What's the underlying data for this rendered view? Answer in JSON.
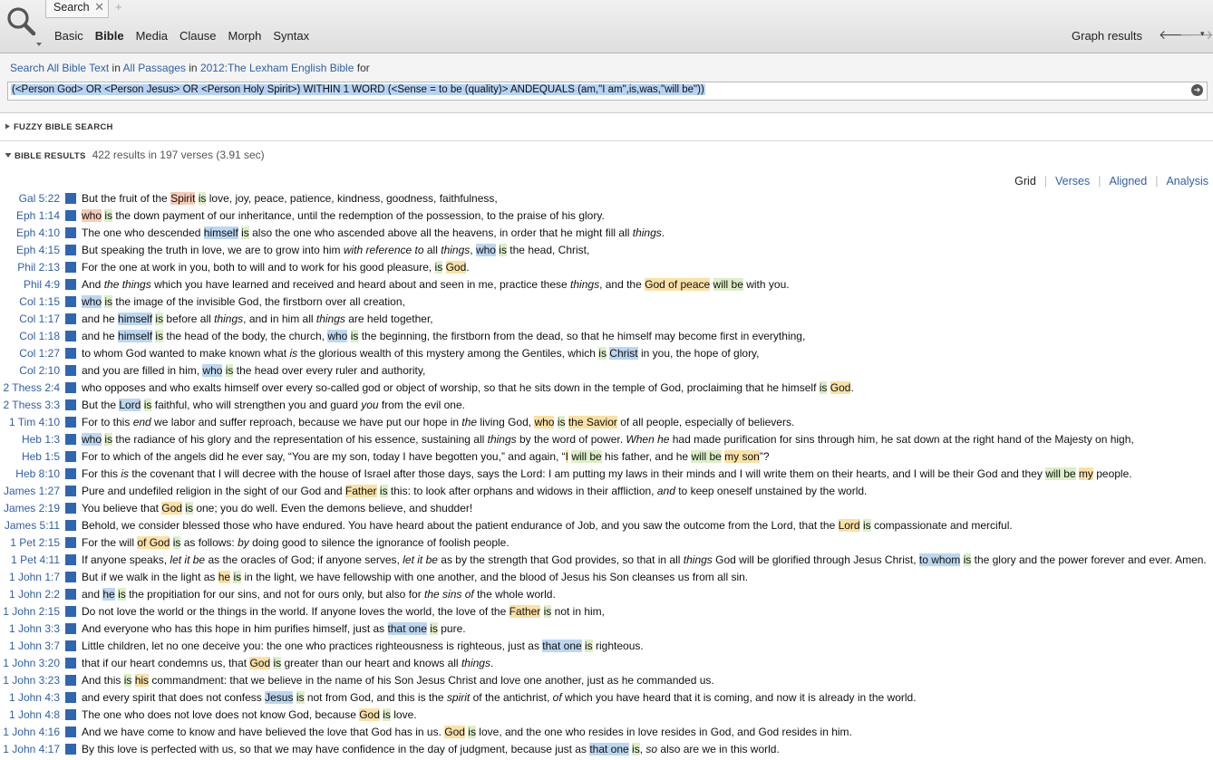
{
  "app": {
    "tab_label": "Search",
    "tab_close": "✕",
    "tab_new": "+",
    "modes": [
      "Basic",
      "Bible",
      "Media",
      "Clause",
      "Morph",
      "Syntax"
    ],
    "active_mode": "Bible",
    "graph_results_label": "Graph results",
    "nav_back": "🡐",
    "nav_forward": "🡒",
    "nav_menu": "▾"
  },
  "criteria": {
    "search_label": "Search",
    "scope_label": "All Bible Text",
    "in1": "in",
    "passages_label": "All Passages",
    "in2": "in",
    "resource_label": "2012:The Lexham English Bible",
    "for_label": "for",
    "query": "(<Person God> OR <Person Jesus> OR <Person Holy Spirit>) WITHIN 1 WORD (<Sense = to be (quality)> ANDEQUALS (am,\"I am\",is,was,\"will be\"))",
    "go_icon": "➔"
  },
  "sections": {
    "fuzzy_label": "FUZZY BIBLE SEARCH",
    "results_label": "BIBLE RESULTS",
    "results_count": "422 results in 197 verses (3.91 sec)"
  },
  "views": [
    "Grid",
    "Verses",
    "Aligned",
    "Analysis"
  ],
  "current_view": "Grid",
  "colors": {
    "link": "#2f5fa8",
    "marker": "#2f66b2",
    "hl_blue": "#bcd7f0",
    "hl_yellow": "#fbe1a6",
    "hl_green": "#dcefc8",
    "hl_orange": "#f6cbb5"
  },
  "results": [
    {
      "ref": "Gal 5:22",
      "segs": [
        [
          "But the fruit of the ",
          ""
        ],
        [
          "Spirit",
          "h4"
        ],
        [
          " ",
          ""
        ],
        [
          "is",
          "h3"
        ],
        [
          " love, joy, peace, patience, kindness, goodness, faithfulness,",
          ""
        ]
      ]
    },
    {
      "ref": "Eph 1:14",
      "segs": [
        [
          "who",
          "h4"
        ],
        [
          " ",
          ""
        ],
        [
          "is",
          "h3"
        ],
        [
          " the down payment of our inheritance, until the redemption of the possession, to the praise of his glory.",
          ""
        ]
      ]
    },
    {
      "ref": "Eph 4:10",
      "segs": [
        [
          "The one who descended ",
          ""
        ],
        [
          "himself",
          "h1"
        ],
        [
          " ",
          ""
        ],
        [
          "is",
          "h3"
        ],
        [
          " also the one who ascended above all the heavens, in order that he might fill all ",
          ""
        ],
        [
          "things",
          "i"
        ],
        [
          ".",
          ""
        ]
      ]
    },
    {
      "ref": "Eph 4:15",
      "segs": [
        [
          "But speaking the truth in love, we are to grow into him ",
          ""
        ],
        [
          "with reference to",
          "i"
        ],
        [
          " all ",
          ""
        ],
        [
          "things",
          "i"
        ],
        [
          ", ",
          ""
        ],
        [
          "who",
          "h1"
        ],
        [
          " ",
          ""
        ],
        [
          "is",
          "h3"
        ],
        [
          " the head, Christ,",
          ""
        ]
      ]
    },
    {
      "ref": "Phil 2:13",
      "segs": [
        [
          "For the one at work in you, both to will and to work for his good pleasure, ",
          ""
        ],
        [
          "is",
          "h3"
        ],
        [
          " ",
          ""
        ],
        [
          "God",
          "h2"
        ],
        [
          ".",
          ""
        ]
      ]
    },
    {
      "ref": "Phil 4:9",
      "segs": [
        [
          "And ",
          ""
        ],
        [
          "the things",
          "i"
        ],
        [
          " which you have learned and received and heard about and seen in me, practice these ",
          ""
        ],
        [
          "things",
          "i"
        ],
        [
          ", and the ",
          ""
        ],
        [
          "God of peace",
          "h2"
        ],
        [
          " ",
          ""
        ],
        [
          "will be",
          "h3"
        ],
        [
          " with you.",
          ""
        ]
      ]
    },
    {
      "ref": "Col 1:15",
      "segs": [
        [
          "who",
          "h1"
        ],
        [
          " ",
          ""
        ],
        [
          "is",
          "h3"
        ],
        [
          " the image of the invisible God, the firstborn over all creation,",
          ""
        ]
      ]
    },
    {
      "ref": "Col 1:17",
      "segs": [
        [
          "and he ",
          ""
        ],
        [
          "himself",
          "h1"
        ],
        [
          " ",
          ""
        ],
        [
          "is",
          "h3"
        ],
        [
          " before all ",
          ""
        ],
        [
          "things",
          "i"
        ],
        [
          ", and in him all ",
          ""
        ],
        [
          "things",
          "i"
        ],
        [
          " are held together,",
          ""
        ]
      ]
    },
    {
      "ref": "Col 1:18",
      "segs": [
        [
          "and he ",
          ""
        ],
        [
          "himself",
          "h1"
        ],
        [
          " ",
          ""
        ],
        [
          "is",
          "h3"
        ],
        [
          " the head of the body, the church, ",
          ""
        ],
        [
          "who",
          "h1"
        ],
        [
          " ",
          ""
        ],
        [
          "is",
          "h3"
        ],
        [
          " the beginning, the firstborn from the dead, so that he himself may become first in everything,",
          ""
        ]
      ]
    },
    {
      "ref": "Col 1:27",
      "segs": [
        [
          "to whom God wanted to make known what ",
          ""
        ],
        [
          "is",
          "i"
        ],
        [
          " the glorious wealth of this mystery among the Gentiles, which ",
          ""
        ],
        [
          "is",
          "h3"
        ],
        [
          " ",
          ""
        ],
        [
          "Christ",
          "h1"
        ],
        [
          " in you, the hope of glory,",
          ""
        ]
      ]
    },
    {
      "ref": "Col 2:10",
      "segs": [
        [
          "and you are filled in him, ",
          ""
        ],
        [
          "who",
          "h1"
        ],
        [
          " ",
          ""
        ],
        [
          "is",
          "h3"
        ],
        [
          " the head over every ruler and authority,",
          ""
        ]
      ]
    },
    {
      "ref": "2 Thess 2:4",
      "segs": [
        [
          "who opposes and who exalts himself over every so-called god or object of worship, so that he sits down in the temple of God, proclaiming that he himself ",
          ""
        ],
        [
          "is",
          "h3"
        ],
        [
          " ",
          ""
        ],
        [
          "God",
          "h2"
        ],
        [
          ".",
          ""
        ]
      ]
    },
    {
      "ref": "2 Thess 3:3",
      "segs": [
        [
          "But the ",
          ""
        ],
        [
          "Lord",
          "h1"
        ],
        [
          " ",
          ""
        ],
        [
          "is",
          "h3"
        ],
        [
          " faithful, who will strengthen you and guard ",
          ""
        ],
        [
          "you",
          "i"
        ],
        [
          " from the evil one.",
          ""
        ]
      ]
    },
    {
      "ref": "1 Tim 4:10",
      "segs": [
        [
          "For to this ",
          ""
        ],
        [
          "end",
          "i"
        ],
        [
          " we labor and suffer reproach, because we have put our hope in ",
          ""
        ],
        [
          "the",
          "i"
        ],
        [
          " living God, ",
          ""
        ],
        [
          "who",
          "h2"
        ],
        [
          " ",
          ""
        ],
        [
          "is",
          "h3"
        ],
        [
          " ",
          ""
        ],
        [
          "the Savior",
          "h2"
        ],
        [
          " of all people, especially of believers.",
          ""
        ]
      ]
    },
    {
      "ref": "Heb 1:3",
      "segs": [
        [
          "who",
          "h1"
        ],
        [
          " ",
          ""
        ],
        [
          "is",
          "h3"
        ],
        [
          " the radiance of his glory and the representation of his essence, sustaining all ",
          ""
        ],
        [
          "things",
          "i"
        ],
        [
          " by the word of power. ",
          ""
        ],
        [
          "When he",
          "i"
        ],
        [
          " had made purification for sins through him, he sat down at the right hand of the Majesty on high,",
          ""
        ]
      ]
    },
    {
      "ref": "Heb 1:5",
      "segs": [
        [
          "For to which of the angels did he ever say, “You are my son, today I have begotten you,” and again, “",
          ""
        ],
        [
          "I",
          "h2"
        ],
        [
          " ",
          ""
        ],
        [
          "will be",
          "h3"
        ],
        [
          " his father, and he ",
          ""
        ],
        [
          "will be",
          "h3"
        ],
        [
          " ",
          ""
        ],
        [
          "my son",
          "h2"
        ],
        [
          "”?",
          ""
        ]
      ]
    },
    {
      "ref": "Heb 8:10",
      "segs": [
        [
          "For this ",
          ""
        ],
        [
          "is",
          "i"
        ],
        [
          " the covenant that I will decree with the house of Israel after those days, says the Lord: I am putting my laws in their minds and I will write them on their hearts, and I will be their God and they ",
          ""
        ],
        [
          "will be",
          "h3"
        ],
        [
          " ",
          ""
        ],
        [
          "my",
          "h2"
        ],
        [
          " people.",
          ""
        ]
      ]
    },
    {
      "ref": "James 1:27",
      "segs": [
        [
          "Pure and undefiled religion in the sight of our God and ",
          ""
        ],
        [
          "Father",
          "h2"
        ],
        [
          " ",
          ""
        ],
        [
          "is",
          "h3"
        ],
        [
          " this: to look after orphans and widows in their affliction, ",
          ""
        ],
        [
          "and",
          "i"
        ],
        [
          " to keep oneself unstained by the world.",
          ""
        ]
      ]
    },
    {
      "ref": "James 2:19",
      "segs": [
        [
          "You believe that ",
          ""
        ],
        [
          "God",
          "h2"
        ],
        [
          " ",
          ""
        ],
        [
          "is",
          "h3"
        ],
        [
          " one; you do well. Even the demons believe, and shudder!",
          ""
        ]
      ]
    },
    {
      "ref": "James 5:11",
      "segs": [
        [
          "Behold, we consider blessed those who have endured. You have heard about the patient endurance of Job, and you saw the outcome from the Lord, that the ",
          ""
        ],
        [
          "Lord",
          "h2"
        ],
        [
          " ",
          ""
        ],
        [
          "is",
          "h3"
        ],
        [
          " compassionate and merciful.",
          ""
        ]
      ]
    },
    {
      "ref": "1 Pet 2:15",
      "segs": [
        [
          "For the will ",
          ""
        ],
        [
          "of God",
          "h2"
        ],
        [
          " ",
          ""
        ],
        [
          "is",
          "h3"
        ],
        [
          " as follows: ",
          ""
        ],
        [
          "by",
          "i"
        ],
        [
          " doing good to silence the ignorance of foolish people.",
          ""
        ]
      ]
    },
    {
      "ref": "1 Pet 4:11",
      "segs": [
        [
          "If anyone speaks, ",
          ""
        ],
        [
          "let it be",
          "i"
        ],
        [
          " as the oracles of God; if anyone serves, ",
          ""
        ],
        [
          "let it be",
          "i"
        ],
        [
          " as by the strength that God provides, so that in all ",
          ""
        ],
        [
          "things",
          "i"
        ],
        [
          " God will be glorified through Jesus Christ, ",
          ""
        ],
        [
          "to whom",
          "h1"
        ],
        [
          " ",
          ""
        ],
        [
          "is",
          "h3"
        ],
        [
          " the glory and the power forever and ever. Amen.",
          ""
        ]
      ]
    },
    {
      "ref": "1 John 1:7",
      "segs": [
        [
          "But if we walk in the light as ",
          ""
        ],
        [
          "he",
          "h2"
        ],
        [
          " ",
          ""
        ],
        [
          "is",
          "h3"
        ],
        [
          " in the light, we have fellowship with one another, and the blood of Jesus his Son cleanses us from all sin.",
          ""
        ]
      ]
    },
    {
      "ref": "1 John 2:2",
      "segs": [
        [
          "and ",
          ""
        ],
        [
          "he",
          "h1"
        ],
        [
          " ",
          ""
        ],
        [
          "is",
          "h3"
        ],
        [
          " the propitiation for our sins, and not for ours only, but also for ",
          ""
        ],
        [
          "the sins of",
          "i"
        ],
        [
          " the whole world.",
          ""
        ]
      ]
    },
    {
      "ref": "1 John 2:15",
      "segs": [
        [
          "Do not love the world or the things in the world. If anyone loves the world, the love of the ",
          ""
        ],
        [
          "Father",
          "h2"
        ],
        [
          " ",
          ""
        ],
        [
          "is",
          "h3"
        ],
        [
          " not in him,",
          ""
        ]
      ]
    },
    {
      "ref": "1 John 3:3",
      "segs": [
        [
          "And everyone who has this hope in him purifies himself, just as ",
          ""
        ],
        [
          "that one",
          "h1"
        ],
        [
          " ",
          ""
        ],
        [
          "is",
          "h3"
        ],
        [
          " pure.",
          ""
        ]
      ]
    },
    {
      "ref": "1 John 3:7",
      "segs": [
        [
          "Little children, let no one deceive you: the one who practices righteousness is righteous, just as ",
          ""
        ],
        [
          "that one",
          "h1"
        ],
        [
          " ",
          ""
        ],
        [
          "is",
          "h3"
        ],
        [
          " righteous.",
          ""
        ]
      ]
    },
    {
      "ref": "1 John 3:20",
      "segs": [
        [
          "that if our heart condemns us, that ",
          ""
        ],
        [
          "God",
          "h2"
        ],
        [
          " ",
          ""
        ],
        [
          "is",
          "h3"
        ],
        [
          " greater than our heart and knows all ",
          ""
        ],
        [
          "things",
          "i"
        ],
        [
          ".",
          ""
        ]
      ]
    },
    {
      "ref": "1 John 3:23",
      "segs": [
        [
          "And this ",
          ""
        ],
        [
          "is",
          "h3"
        ],
        [
          " ",
          ""
        ],
        [
          "his",
          "h2"
        ],
        [
          " commandment: that we believe in the name of his Son Jesus Christ and love one another, just as he commanded us.",
          ""
        ]
      ]
    },
    {
      "ref": "1 John 4:3",
      "segs": [
        [
          "and every spirit that does not confess ",
          ""
        ],
        [
          "Jesus",
          "h1"
        ],
        [
          " ",
          ""
        ],
        [
          "is",
          "h3"
        ],
        [
          " not from God, and this is the ",
          ""
        ],
        [
          "spirit",
          "i"
        ],
        [
          " of the antichrist, ",
          ""
        ],
        [
          "of",
          "i"
        ],
        [
          " which you have heard that it is coming, and now it is already in the world.",
          ""
        ]
      ]
    },
    {
      "ref": "1 John 4:8",
      "segs": [
        [
          "The one who does not love does not know God, because ",
          ""
        ],
        [
          "God",
          "h2"
        ],
        [
          " ",
          ""
        ],
        [
          "is",
          "h3"
        ],
        [
          " love.",
          ""
        ]
      ]
    },
    {
      "ref": "1 John 4:16",
      "segs": [
        [
          "And we have come to know and have believed the love that God has in us. ",
          ""
        ],
        [
          "God",
          "h2"
        ],
        [
          " ",
          ""
        ],
        [
          "is",
          "h3"
        ],
        [
          " love, and the one who resides in love resides in God, and God resides in him.",
          ""
        ]
      ]
    },
    {
      "ref": "1 John 4:17",
      "segs": [
        [
          "By this love is perfected with us, so that we may have confidence in the day of judgment, because just as ",
          ""
        ],
        [
          "that one",
          "h1"
        ],
        [
          " ",
          ""
        ],
        [
          "is",
          "h3"
        ],
        [
          ", ",
          ""
        ],
        [
          "so",
          "i"
        ],
        [
          " also are we in this world.",
          ""
        ]
      ]
    }
  ]
}
